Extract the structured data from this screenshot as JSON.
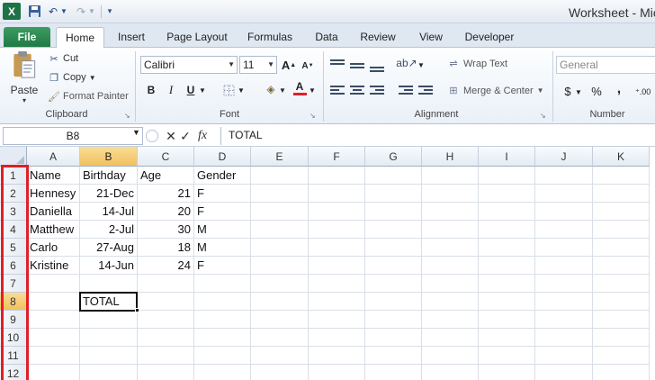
{
  "app": {
    "logo_letter": "X",
    "window_title": "Worksheet - Mic"
  },
  "tabs": [
    "File",
    "Home",
    "Insert",
    "Page Layout",
    "Formulas",
    "Data",
    "Review",
    "View",
    "Developer"
  ],
  "ribbon": {
    "clipboard": {
      "paste": "Paste",
      "cut": "Cut",
      "copy": "Copy",
      "format_painter": "Format Painter",
      "label": "Clipboard"
    },
    "font": {
      "name": "Calibri",
      "size": "11",
      "bold": "B",
      "italic": "I",
      "underline": "U",
      "label": "Font",
      "font_color": "A"
    },
    "alignment": {
      "wrap_text": "Wrap Text",
      "merge_center": "Merge & Center",
      "label": "Alignment"
    },
    "number": {
      "format": "General",
      "currency": "$",
      "percent": "%",
      "comma": ",",
      "label": "Number"
    }
  },
  "formula_bar": {
    "name_box": "B8",
    "fx_label": "fx",
    "content": "TOTAL"
  },
  "sheet": {
    "columns": [
      "A",
      "B",
      "C",
      "D",
      "E",
      "F",
      "G",
      "H",
      "I",
      "J",
      "K"
    ],
    "selected_column": "B",
    "rows": [
      "1",
      "2",
      "3",
      "4",
      "5",
      "6",
      "7",
      "8",
      "9",
      "10",
      "11",
      "12"
    ],
    "selected_row": "8",
    "active_cell": "B8",
    "data": [
      [
        "Name",
        "Birthday",
        "Age",
        "Gender"
      ],
      [
        "Hennesy",
        "21-Dec",
        "21",
        "F"
      ],
      [
        "Daniella",
        "14-Jul",
        "20",
        "F"
      ],
      [
        "Matthew",
        "2-Jul",
        "30",
        "M"
      ],
      [
        "Carlo",
        "27-Aug",
        "18",
        "M"
      ],
      [
        "Kristine",
        "14-Jun",
        "24",
        "F"
      ],
      [
        "",
        "",
        "",
        ""
      ],
      [
        "",
        "TOTAL",
        "",
        ""
      ]
    ],
    "highlight_color": "#e01f26"
  }
}
